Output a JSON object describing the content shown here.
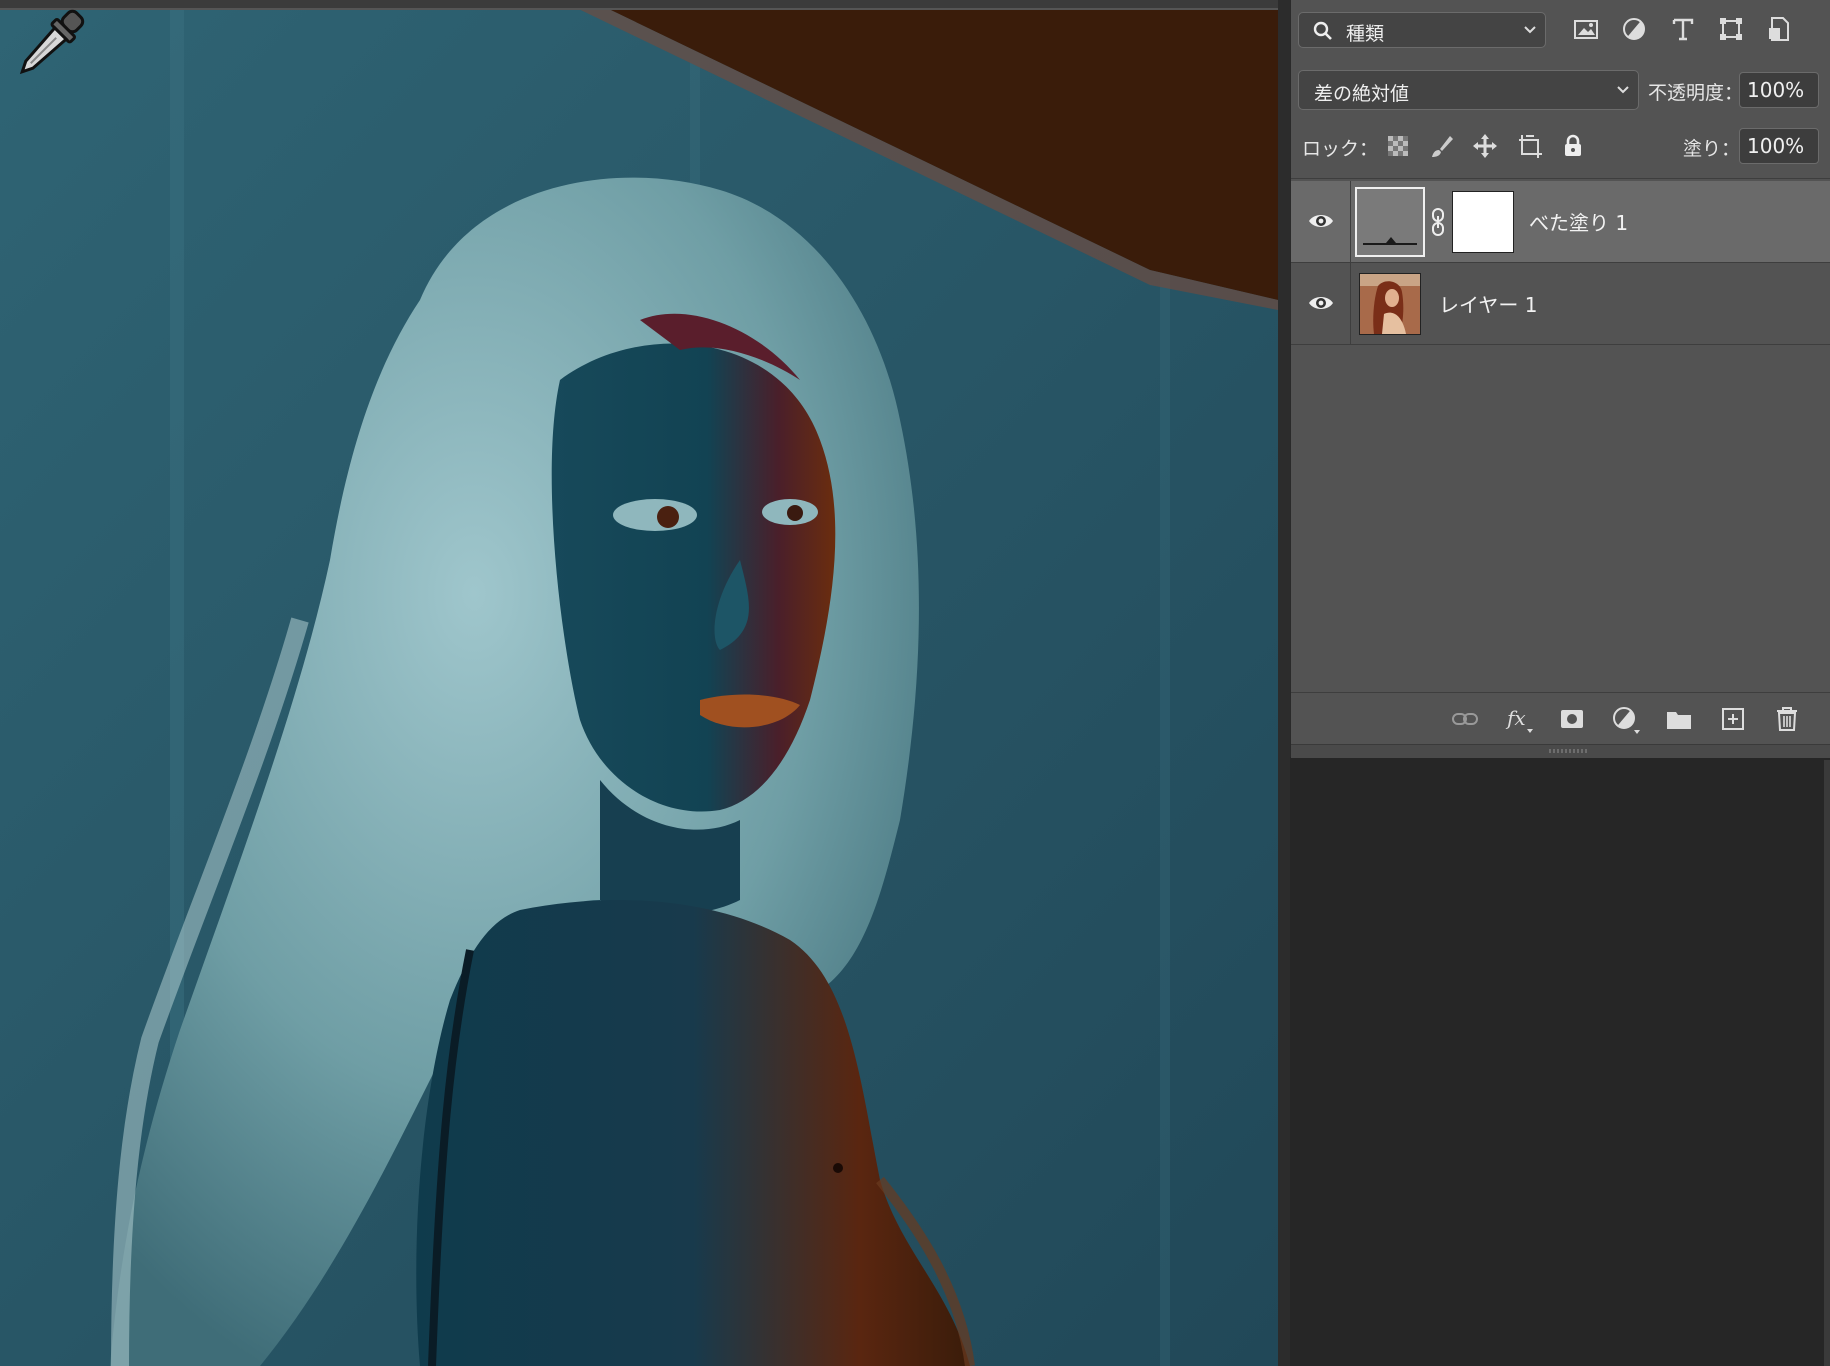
{
  "layers_panel": {
    "filter_kind": "種類",
    "filter_icons": [
      "image-filter-icon",
      "adjustment-filter-icon",
      "type-filter-icon",
      "shape-filter-icon",
      "smart-object-filter-icon"
    ],
    "blend_mode": "差の絶対値",
    "opacity_label": "不透明度：",
    "opacity_value": "100%",
    "lock_label": "ロック：",
    "lock_icons": [
      "lock-transparent-pixels-icon",
      "lock-image-pixels-icon",
      "lock-position-icon",
      "lock-artboard-icon",
      "lock-all-icon"
    ],
    "fill_label": "塗り：",
    "fill_value": "100%",
    "layers": [
      {
        "name": "べた塗り 1",
        "type": "solid-color-fill",
        "visible": true,
        "selected": true,
        "fill_color": "#7a7a7a"
      },
      {
        "name": "レイヤー 1",
        "type": "pixel",
        "visible": true,
        "selected": false
      }
    ],
    "footer_icons": [
      "link-layers-icon",
      "fx-icon",
      "add-mask-icon",
      "adjustment-layer-icon",
      "new-group-icon",
      "new-layer-icon",
      "delete-layer-icon"
    ]
  },
  "canvas": {
    "content": "inverted-color photo of a woman with long hair looking over her shoulder",
    "tool_cursor": "eyedropper-icon"
  },
  "colors": {
    "panel_bg": "#535353",
    "selected_row": "#6a6a6a",
    "app_bg": "#262626",
    "canvas_teal": "#2b5866",
    "canvas_brown": "#3a1c0a"
  }
}
